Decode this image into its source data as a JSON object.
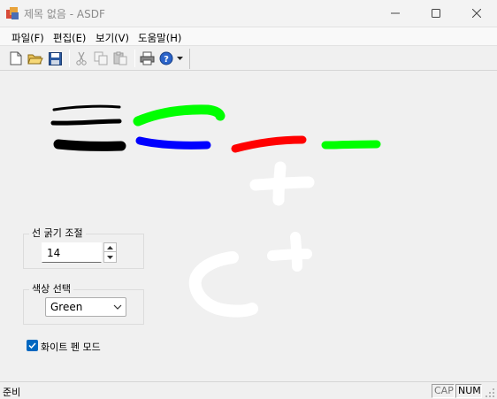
{
  "window": {
    "title": "제목 없음 - ASDF",
    "controls": [
      "minimize-icon",
      "maximize-icon",
      "close-icon"
    ]
  },
  "menu": {
    "file": "파일(F)",
    "edit": "편집(E)",
    "view": "보기(V)",
    "help": "도움말(H)"
  },
  "toolbar": {
    "buttons": [
      "new-document-icon",
      "open-folder-icon",
      "save-icon",
      "cut-icon",
      "copy-icon",
      "paste-icon",
      "print-icon",
      "help-icon",
      "dropdown-arrow-icon"
    ]
  },
  "canvas": {
    "stroke_colors": [
      "#000000",
      "#00ff00",
      "#0000ff",
      "#ff0000",
      "#ffffff"
    ]
  },
  "line_thickness": {
    "label": "선 굵기 조절",
    "value": "14"
  },
  "color_select": {
    "label": "색상 선택",
    "selected": "Green"
  },
  "white_pen": {
    "label": "화이트 펜 모드",
    "checked": true
  },
  "status": {
    "text": "준비",
    "cap": "CAP",
    "num": "NUM"
  },
  "colors": {
    "accent": "#0067c0",
    "background": "#f0f0f0"
  }
}
